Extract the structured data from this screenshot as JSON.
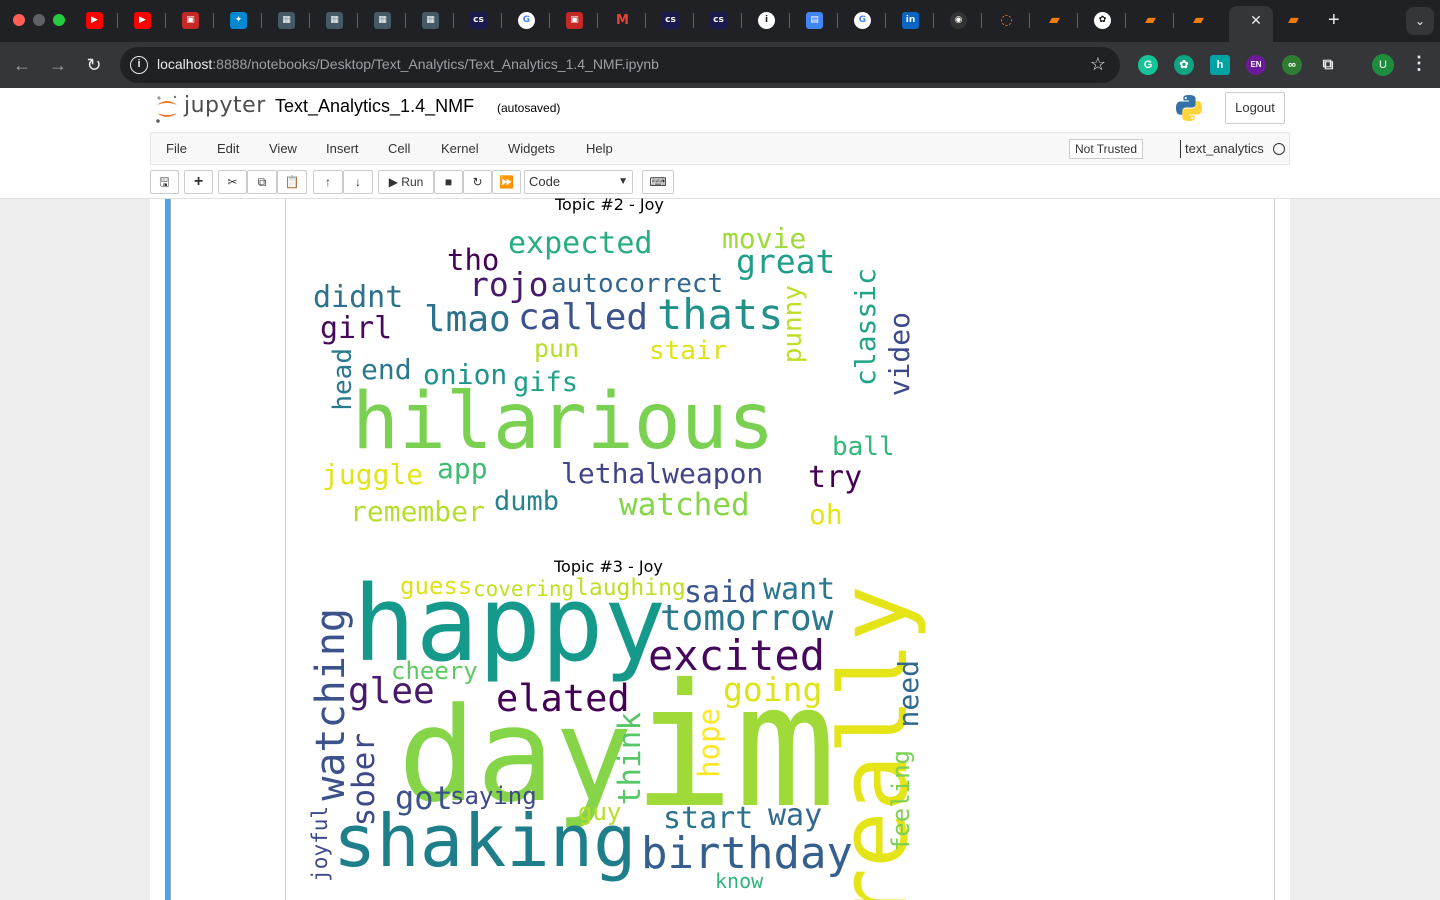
{
  "browser": {
    "url_host": "localhost",
    "url_path": ":8888/notebooks/Desktop/Text_Analytics/Text_Analytics_1.4_NMF.ipynb",
    "extensions": [
      "G",
      "h",
      "EN",
      "U"
    ]
  },
  "jupyter": {
    "logo_text": "jupyter",
    "notebook_name": "Text_Analytics_1.4_NMF",
    "autosave": "(autosaved)",
    "logout": "Logout",
    "menu": [
      "File",
      "Edit",
      "View",
      "Insert",
      "Cell",
      "Kernel",
      "Widgets",
      "Help"
    ],
    "trust": "Not Trusted",
    "kernel": "text_analytics",
    "toolbar": {
      "run_label": "Run",
      "cell_type": "Code"
    }
  },
  "wordclouds": [
    {
      "title": "Topic #2 - Joy",
      "words": [
        "hilarious",
        "thats",
        "called",
        "lmao",
        "rojo",
        "autocorrect",
        "expected",
        "movie",
        "great",
        "tho",
        "didnt",
        "girl",
        "punny",
        "classic",
        "video",
        "pun",
        "stair",
        "head",
        "end",
        "onion",
        "gifs",
        "ball",
        "juggle",
        "app",
        "lethalweapon",
        "try",
        "remember",
        "dumb",
        "watched",
        "oh"
      ]
    },
    {
      "title": "Topic #3 - Joy",
      "words": [
        "happy",
        "day",
        "im",
        "really",
        "shaking",
        "birthday",
        "guess",
        "covering",
        "laughing",
        "said",
        "want",
        "tomorrow",
        "watching",
        "cheery",
        "excited",
        "glee",
        "elated",
        "going",
        "need",
        "hope",
        "think",
        "sober",
        "got",
        "saying",
        "feeling",
        "guy",
        "start",
        "way",
        "joyful",
        "know"
      ]
    }
  ]
}
